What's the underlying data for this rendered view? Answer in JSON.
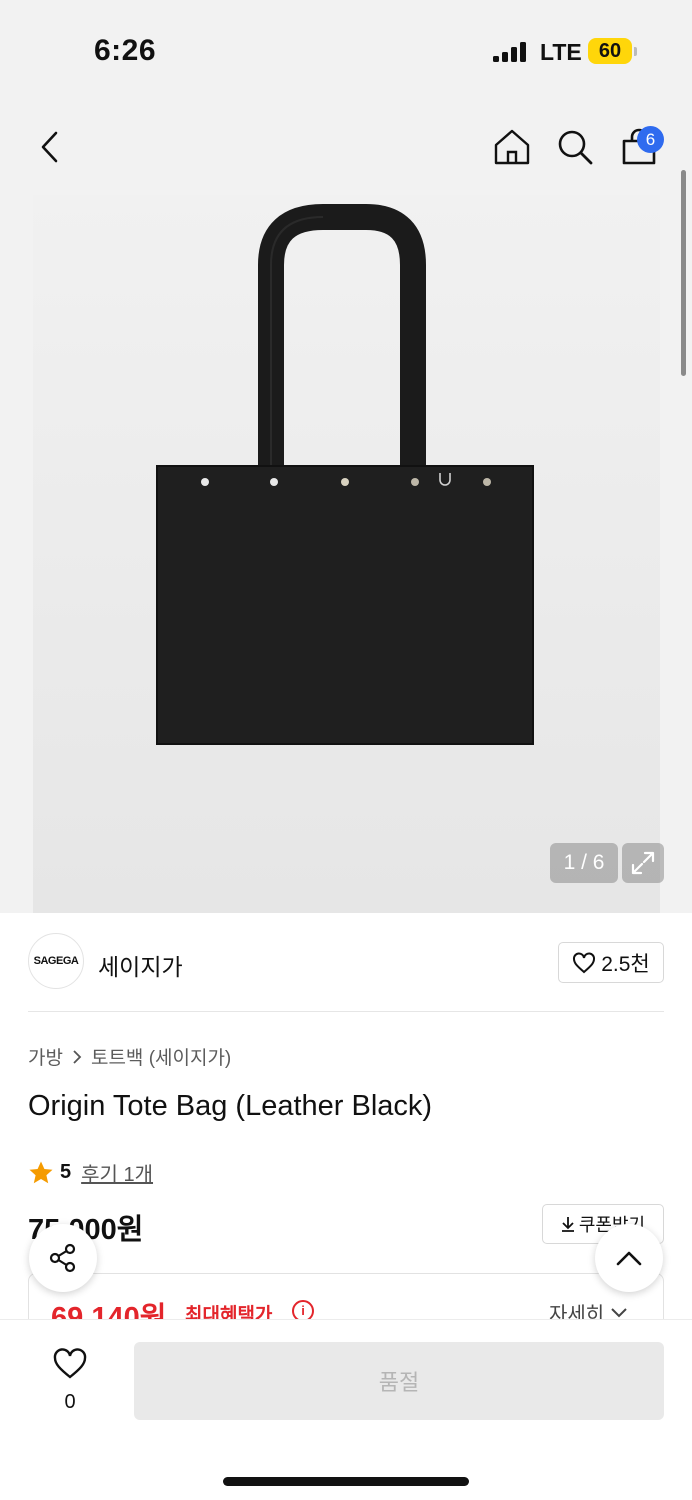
{
  "status_bar": {
    "time": "6:26",
    "network": "LTE",
    "battery": "60"
  },
  "nav": {
    "back_icon": "chevron-left-icon",
    "home_icon": "home-icon",
    "search_icon": "search-icon",
    "cart_icon": "shopping-bag-icon",
    "cart_count": "6"
  },
  "gallery": {
    "page_indicator": "1 / 6",
    "expand_icon": "expand-icon"
  },
  "brand": {
    "logo_text": "SAGEGA",
    "name": "세이지가",
    "likes": "2.5천"
  },
  "breadcrumb": {
    "category": "가방",
    "subcategory": "토트백 (세이지가)"
  },
  "product": {
    "title": "Origin Tote Bag (Leather Black)",
    "rating": "5",
    "reviews": "후기 1개",
    "price": "75,000원",
    "coupon_label": "쿠폰받기"
  },
  "benefit": {
    "price": "69,140원",
    "label": "최대혜택가",
    "detail_label": "자세히"
  },
  "bottom_bar": {
    "wish_count": "0",
    "soldout_label": "품절"
  },
  "colors": {
    "accent_red": "#e3252b",
    "badge_blue": "#2f6bef",
    "star": "#f59b00"
  }
}
